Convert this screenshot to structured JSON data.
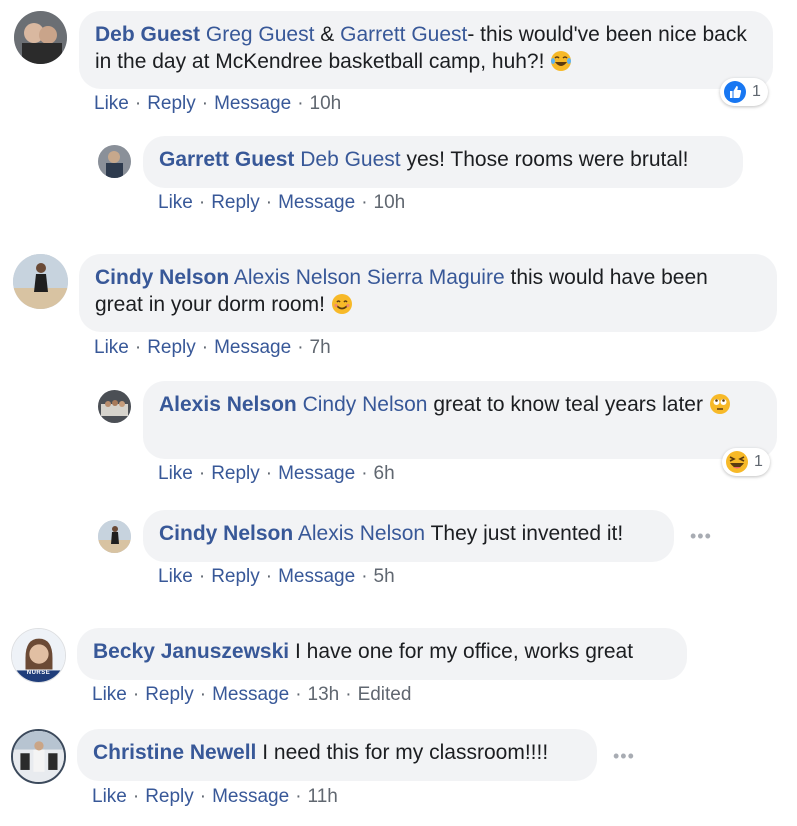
{
  "comments": [
    {
      "author": "Deb Guest",
      "mentions": [
        "Greg Guest",
        "&",
        "Garrett Guest"
      ],
      "text": "- this would've been nice back in the day at McKendree basketball camp, huh?!",
      "actions": {
        "like": "Like",
        "reply": "Reply",
        "message": "Message",
        "time": "10h"
      },
      "reaction_count": "1",
      "reaction_icon": "like-icon"
    },
    {
      "author": "Garrett Guest",
      "mentions": [
        "Deb Guest"
      ],
      "text": "yes! Those rooms were brutal!",
      "actions": {
        "like": "Like",
        "reply": "Reply",
        "message": "Message",
        "time": "10h"
      }
    },
    {
      "author": "Cindy Nelson",
      "mentions": [
        "Alexis Nelson Sierra Maguire"
      ],
      "text": "this would have been great in your dorm room!",
      "actions": {
        "like": "Like",
        "reply": "Reply",
        "message": "Message",
        "time": "7h"
      }
    },
    {
      "author": "Alexis Nelson",
      "mentions": [
        "Cindy Nelson"
      ],
      "text": "great to know teal years later",
      "actions": {
        "like": "Like",
        "reply": "Reply",
        "message": "Message",
        "time": "6h"
      },
      "reaction_count": "1",
      "reaction_icon": "haha-icon"
    },
    {
      "author": "Cindy Nelson",
      "mentions": [
        "Alexis Nelson"
      ],
      "text": "They just invented it!",
      "actions": {
        "like": "Like",
        "reply": "Reply",
        "message": "Message",
        "time": "5h"
      }
    },
    {
      "author": "Becky Januszewski",
      "text": "I have one for my office, works great",
      "actions": {
        "like": "Like",
        "reply": "Reply",
        "message": "Message",
        "time": "13h",
        "edited": "Edited"
      }
    },
    {
      "author": "Christine Newell",
      "text": "I need this for my classroom!!!!",
      "actions": {
        "like": "Like",
        "reply": "Reply",
        "message": "Message",
        "time": "11h"
      }
    }
  ],
  "avatar_badge_text": "NURSE",
  "more_options_icon": "more-options-icon",
  "colors": {
    "link": "#385898",
    "text": "#1c1e21",
    "meta": "#606770",
    "bubble": "#f2f3f5",
    "like_blue": "#1877f2",
    "emoji_yellow": "#f7b928"
  }
}
